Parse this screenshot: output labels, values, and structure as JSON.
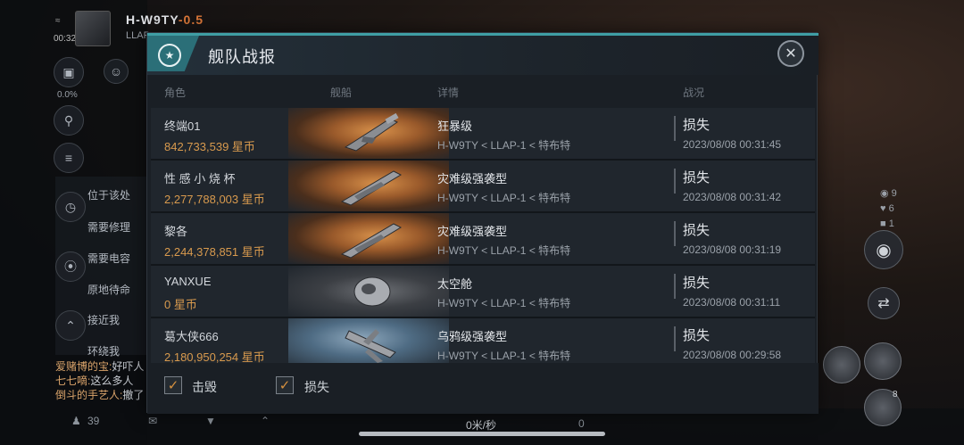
{
  "hud": {
    "system_name": "H-W9TY",
    "security": "-0.5",
    "system_sub": "LLAP",
    "clock": "00:32",
    "cargo_pct": "0.0%",
    "side_items": [
      "位于该处",
      "需要修理",
      "需要电容",
      "原地待命",
      "接近我",
      "环绕我"
    ],
    "chat": [
      {
        "name": "爱赌博的宝",
        "text": "好吓人"
      },
      {
        "name": "七七嘀",
        "text": "这么多人"
      },
      {
        "name": "倒斗的手艺人",
        "text": "撤了"
      }
    ],
    "bottom_count": "39",
    "speed": "0米/秒",
    "speed_value": "0",
    "right_stats": [
      "9",
      "6",
      "1"
    ],
    "bubble_count": "8"
  },
  "modal": {
    "title": "舰队战报",
    "columns": {
      "pilot": "角色",
      "ship": "舰船",
      "details": "详情",
      "status": "战况"
    },
    "rows": [
      {
        "name": "终端01",
        "value": "842,733,539 星币",
        "ship_type": "狂暴级",
        "location": "H-W9TY < LLAP-1 < 特布特",
        "result": "损失",
        "time": "2023/08/08   00:31:45"
      },
      {
        "name": "性 感 小 烧 杯",
        "value": "2,277,788,003 星币",
        "ship_type": "灾难级强袭型",
        "location": "H-W9TY < LLAP-1 < 特布特",
        "result": "损失",
        "time": "2023/08/08   00:31:42"
      },
      {
        "name": "黎各",
        "value": "2,244,378,851 星币",
        "ship_type": "灾难级强袭型",
        "location": "H-W9TY < LLAP-1 < 特布特",
        "result": "损失",
        "time": "2023/08/08   00:31:19"
      },
      {
        "name": "YANXUE",
        "value": "0 星币",
        "ship_type": "太空舱",
        "location": "H-W9TY < LLAP-1 < 特布特",
        "result": "损失",
        "time": "2023/08/08   00:31:11"
      },
      {
        "name": "葛大侠666",
        "value": "2,180,950,254 星币",
        "ship_type": "乌鸦级强袭型",
        "location": "H-W9TY < LLAP-1 < 特布特",
        "result": "损失",
        "time": "2023/08/08   00:29:58"
      }
    ],
    "filters": {
      "destroyed": "击毁",
      "lost": "损失"
    }
  }
}
